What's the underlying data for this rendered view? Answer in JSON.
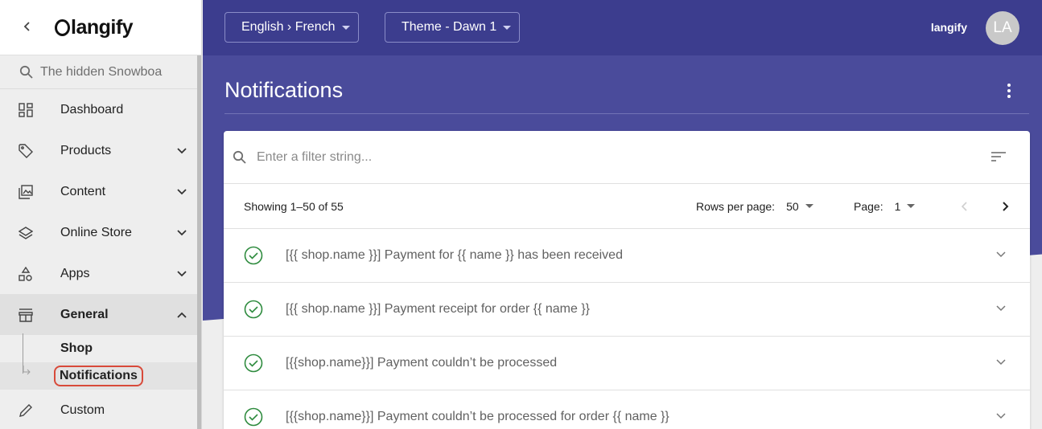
{
  "sidebar": {
    "logo_text": "langify",
    "search_placeholder": "The hidden Snowboa",
    "items": [
      {
        "label": "Dashboard",
        "icon": "dashboard-icon"
      },
      {
        "label": "Products",
        "icon": "tag-icon"
      },
      {
        "label": "Content",
        "icon": "images-icon"
      },
      {
        "label": "Online Store",
        "icon": "layers-icon"
      },
      {
        "label": "Apps",
        "icon": "apps-icon"
      },
      {
        "label": "General",
        "icon": "store-icon"
      },
      {
        "label": "Custom",
        "icon": "pencil-icon"
      }
    ],
    "sub_items": [
      "Shop",
      "Notifications"
    ]
  },
  "topbar": {
    "language_select": "English › French",
    "theme_select": "Theme - Dawn 1",
    "user_name": "langify",
    "avatar_initials": "LA"
  },
  "page": {
    "title": "Notifications"
  },
  "filter": {
    "placeholder": "Enter a filter string..."
  },
  "pagination": {
    "showing": "Showing 1–50 of 55",
    "rows_per_page_label": "Rows per page:",
    "rows_per_page_value": "50",
    "page_label": "Page:",
    "page_value": "1"
  },
  "notifications": [
    {
      "text": "[{{ shop.name }}] Payment for {{ name }} has been received"
    },
    {
      "text": "[{{ shop.name }}] Payment receipt for order {{ name }}"
    },
    {
      "text": "[{{shop.name}}] Payment couldn’t be processed"
    },
    {
      "text": "[{{shop.name}}] Payment couldn’t be processed for order {{ name }}"
    }
  ],
  "colors": {
    "topbar": "#3c3d8e",
    "banner": "#4a4b9b",
    "success": "#2e8b3e",
    "highlight": "#d84a3a"
  }
}
